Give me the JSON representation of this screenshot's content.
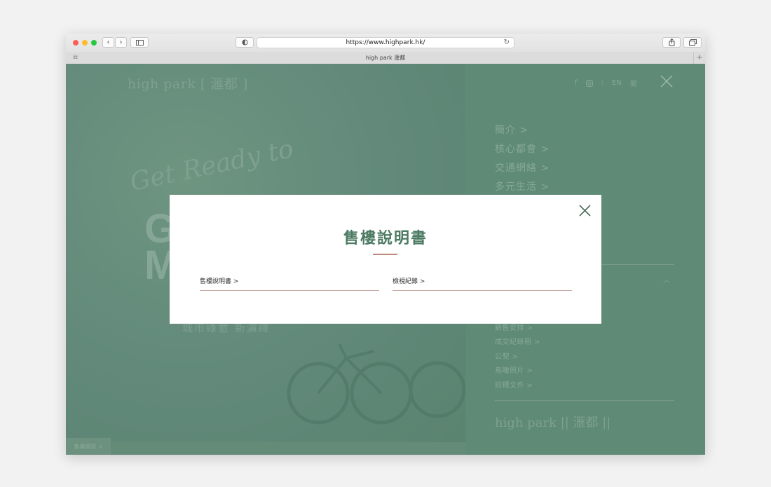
{
  "browser": {
    "url": "https://www.highpark.hk/",
    "tab_title": "high park 滙都",
    "back_glyph": "‹",
    "forward_glyph": "›"
  },
  "site": {
    "logo_text": "high park [ 滙都 ]",
    "footer_logo": "high park || 滙都 ||",
    "hero": {
      "script_text": "Get Ready to",
      "big_text": "G\nM",
      "subtitle": "城市綠意 新演繹",
      "footer_tab": "售樓資訊 >"
    },
    "menu": {
      "lang_en": "EN",
      "lang_zh": "简",
      "items": [
        "簡介 >",
        "核心都會 >",
        "交通網絡 >",
        "多元生活 >"
      ],
      "sub_items": [
        "銷售安排 >",
        "成交紀錄冊 >",
        "公契 >",
        "鳥瞰照片 >",
        "招標文件 >"
      ]
    }
  },
  "modal": {
    "title": "售樓說明書",
    "links": [
      "售樓說明書 >",
      "檢視紀錄 >"
    ]
  },
  "colors": {
    "overlay_green": "#5f8a76",
    "modal_title": "#4c7a63",
    "accent_rule": "#b98c7c"
  }
}
